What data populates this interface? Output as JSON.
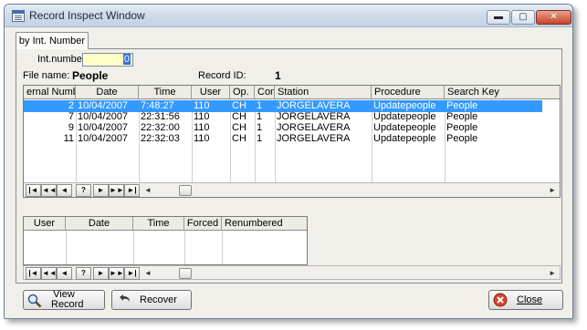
{
  "window": {
    "title": "Record Inspect Window",
    "minimize_glyph": "▬",
    "maximize_glyph": "▢",
    "close_glyph": "✕"
  },
  "tab": {
    "label": "by Int. Number"
  },
  "fields": {
    "int_number_label": "Int.number:",
    "int_number_value": "0",
    "file_name_label": "File name:",
    "file_name_value": "People",
    "record_id_label": "Record ID:",
    "record_id_value": "1"
  },
  "records_table": {
    "columns": [
      "ernal Numb",
      "Date",
      "Time",
      "User",
      "Op.",
      "Com",
      "Station",
      "Procedure",
      "Search Key"
    ],
    "rows": [
      [
        "2",
        "10/04/2007",
        "7:48:27",
        "110",
        "CH",
        "1",
        "JORGELAVERA",
        "Updatepeople",
        "People"
      ],
      [
        "7",
        "10/04/2007",
        "22:31:56",
        "110",
        "CH",
        "1",
        "JORGELAVERA",
        "Updatepeople",
        "People"
      ],
      [
        "9",
        "10/04/2007",
        "22:32:00",
        "110",
        "CH",
        "1",
        "JORGELAVERA",
        "Updatepeople",
        "People"
      ],
      [
        "11",
        "10/04/2007",
        "22:32:03",
        "110",
        "CH",
        "1",
        "JORGELAVERA",
        "Updatepeople",
        "People"
      ]
    ],
    "selected_row": 0
  },
  "detail_table": {
    "columns": [
      "User",
      "Date",
      "Time",
      "Forced",
      "Renumbered"
    ]
  },
  "nav_buttons": {
    "first": "|◄",
    "prev_page": "◄◄",
    "prev": "◄",
    "query": "?",
    "next": "►",
    "next_page": "►►",
    "last": "►|"
  },
  "buttons": {
    "view_record": "View\nRecord",
    "recover": "Recover",
    "close": "Close"
  },
  "colors": {
    "selection": "#3399ff",
    "input_bg": "#ffffc8",
    "window_bg": "#f0efe9"
  }
}
